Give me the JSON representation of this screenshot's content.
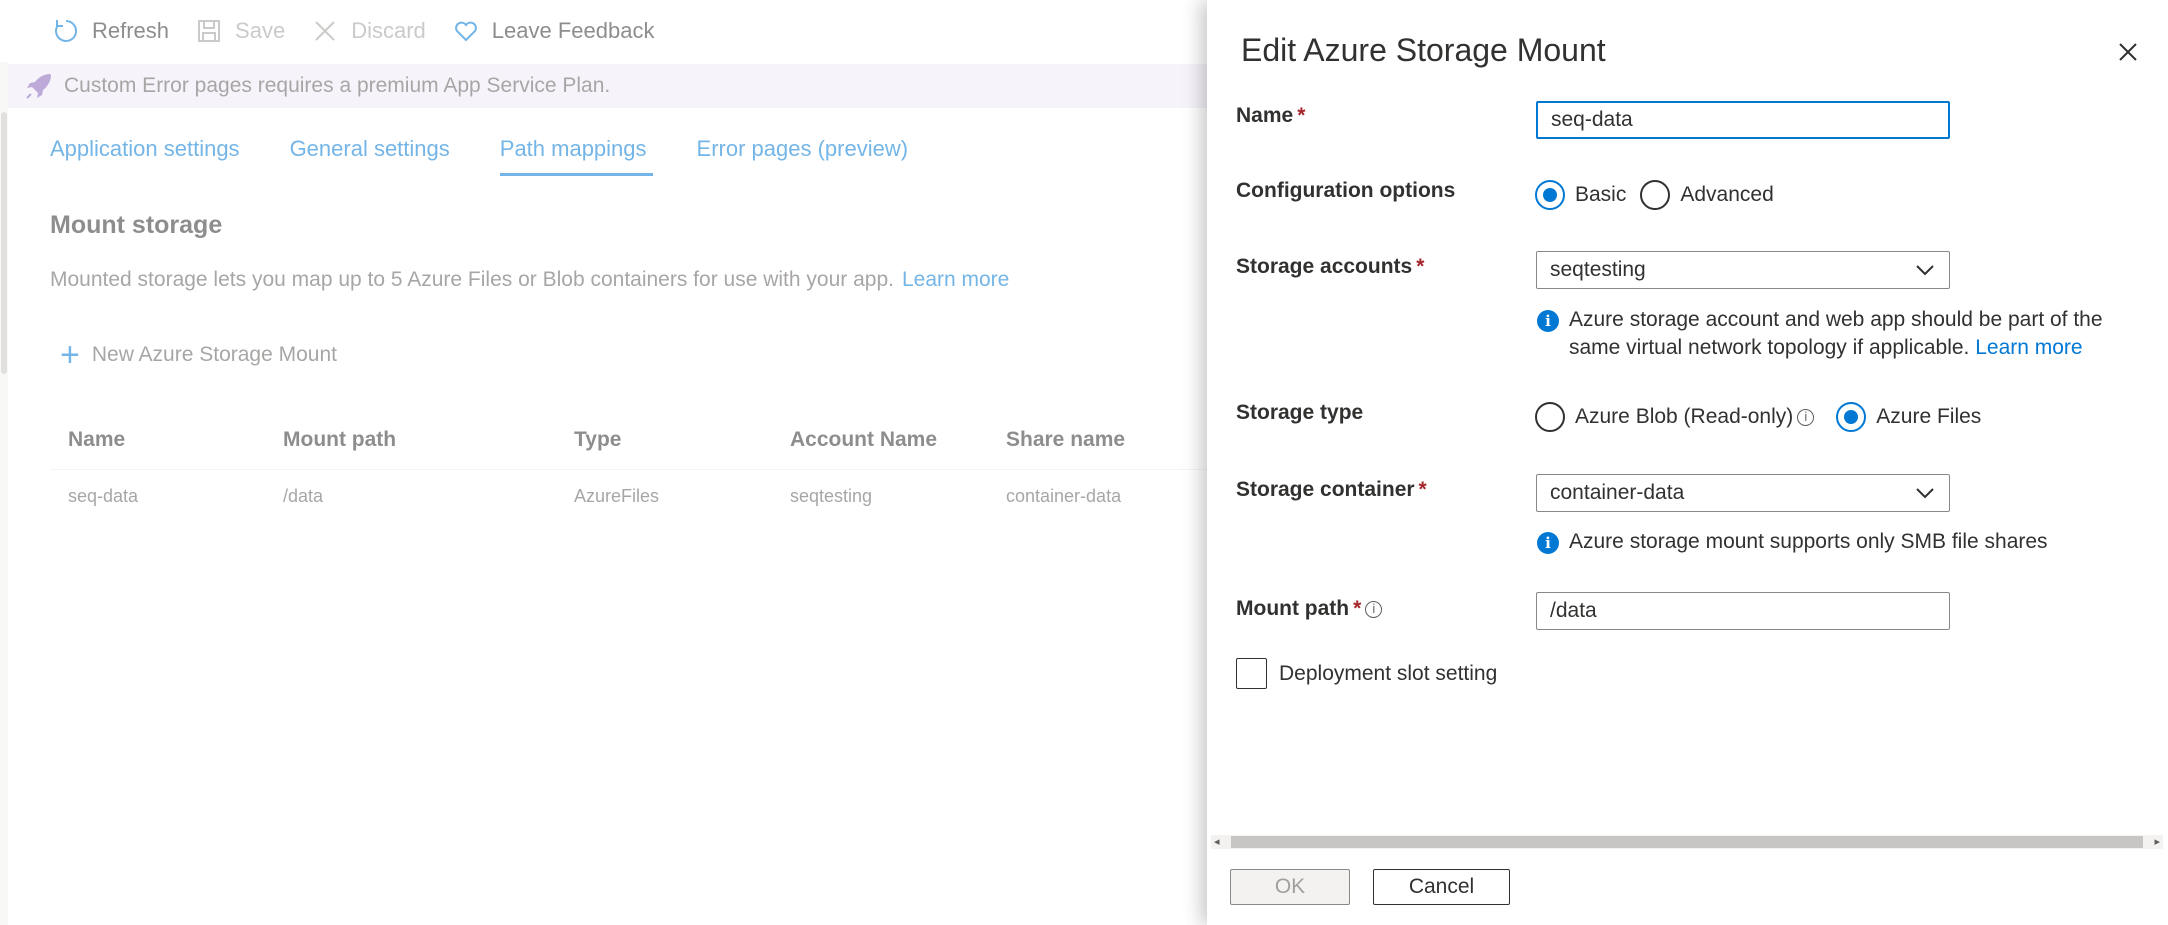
{
  "toolbar": {
    "refresh_label": "Refresh",
    "save_label": "Save",
    "discard_label": "Discard",
    "feedback_label": "Leave Feedback"
  },
  "banner": {
    "text": "Custom Error pages requires a premium App Service Plan."
  },
  "tabs": [
    {
      "label": "Application settings",
      "active": false
    },
    {
      "label": "General settings",
      "active": false
    },
    {
      "label": "Path mappings",
      "active": true
    },
    {
      "label": "Error pages (preview)",
      "active": false
    }
  ],
  "mount": {
    "title": "Mount storage",
    "description": "Mounted storage lets you map up to 5 Azure Files or Blob containers for use with your app.",
    "learn_more": "Learn more",
    "add_label": "New Azure Storage Mount"
  },
  "table": {
    "columns": [
      "Name",
      "Mount path",
      "Type",
      "Account Name",
      "Share name"
    ],
    "rows": [
      [
        "seq-data",
        "/data",
        "AzureFiles",
        "seqtesting",
        "container-data"
      ]
    ]
  },
  "panel": {
    "title": "Edit Azure Storage Mount",
    "name_label": "Name",
    "name_value": "seq-data",
    "config_label": "Configuration options",
    "config_basic": "Basic",
    "config_advanced": "Advanced",
    "config_selected": "Basic",
    "storage_accounts_label": "Storage accounts",
    "storage_accounts_value": "seqtesting",
    "storage_accounts_note": "Azure storage account and web app should be part of the same virtual network topology if applicable.",
    "storage_accounts_note_link": "Learn more",
    "storage_type_label": "Storage type",
    "storage_type_blob": "Azure Blob (Read-only)",
    "storage_type_files": "Azure Files",
    "storage_type_selected": "Azure Files",
    "container_label": "Storage container",
    "container_value": "container-data",
    "container_note": "Azure storage mount supports only SMB file shares",
    "mount_path_label": "Mount path",
    "mount_path_value": "/data",
    "slot_setting_label": "Deployment slot setting",
    "slot_setting_checked": false,
    "ok_label": "OK",
    "cancel_label": "Cancel"
  },
  "colors": {
    "accent": "#0078d4",
    "required": "#a4262c",
    "banner_bg": "#f0eaf7"
  }
}
